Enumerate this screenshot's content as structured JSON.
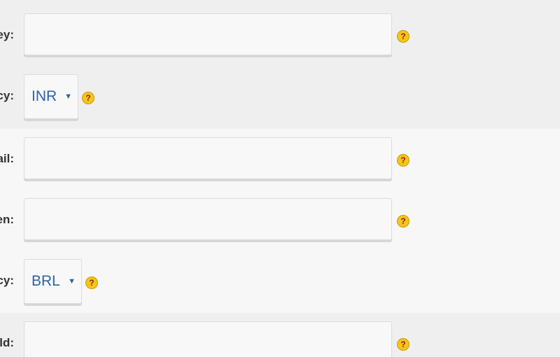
{
  "rows": [
    {
      "label": "ey:",
      "type": "text",
      "value": ""
    },
    {
      "label": "cy:",
      "type": "select",
      "value": "INR"
    },
    {
      "label": "ail:",
      "type": "text",
      "value": ""
    },
    {
      "label": "en:",
      "type": "text",
      "value": ""
    },
    {
      "label": "cy:",
      "type": "select",
      "value": "BRL"
    },
    {
      "label": "ld:",
      "type": "text",
      "value": ""
    }
  ],
  "help_glyph": "?",
  "caret_glyph": "▼",
  "colors": {
    "section_dark": "#efefef",
    "section_light": "#f7f7f7",
    "select_text": "#2a64a6",
    "help_fill": "#f5c518",
    "help_glyph": "#9b1c1c"
  }
}
